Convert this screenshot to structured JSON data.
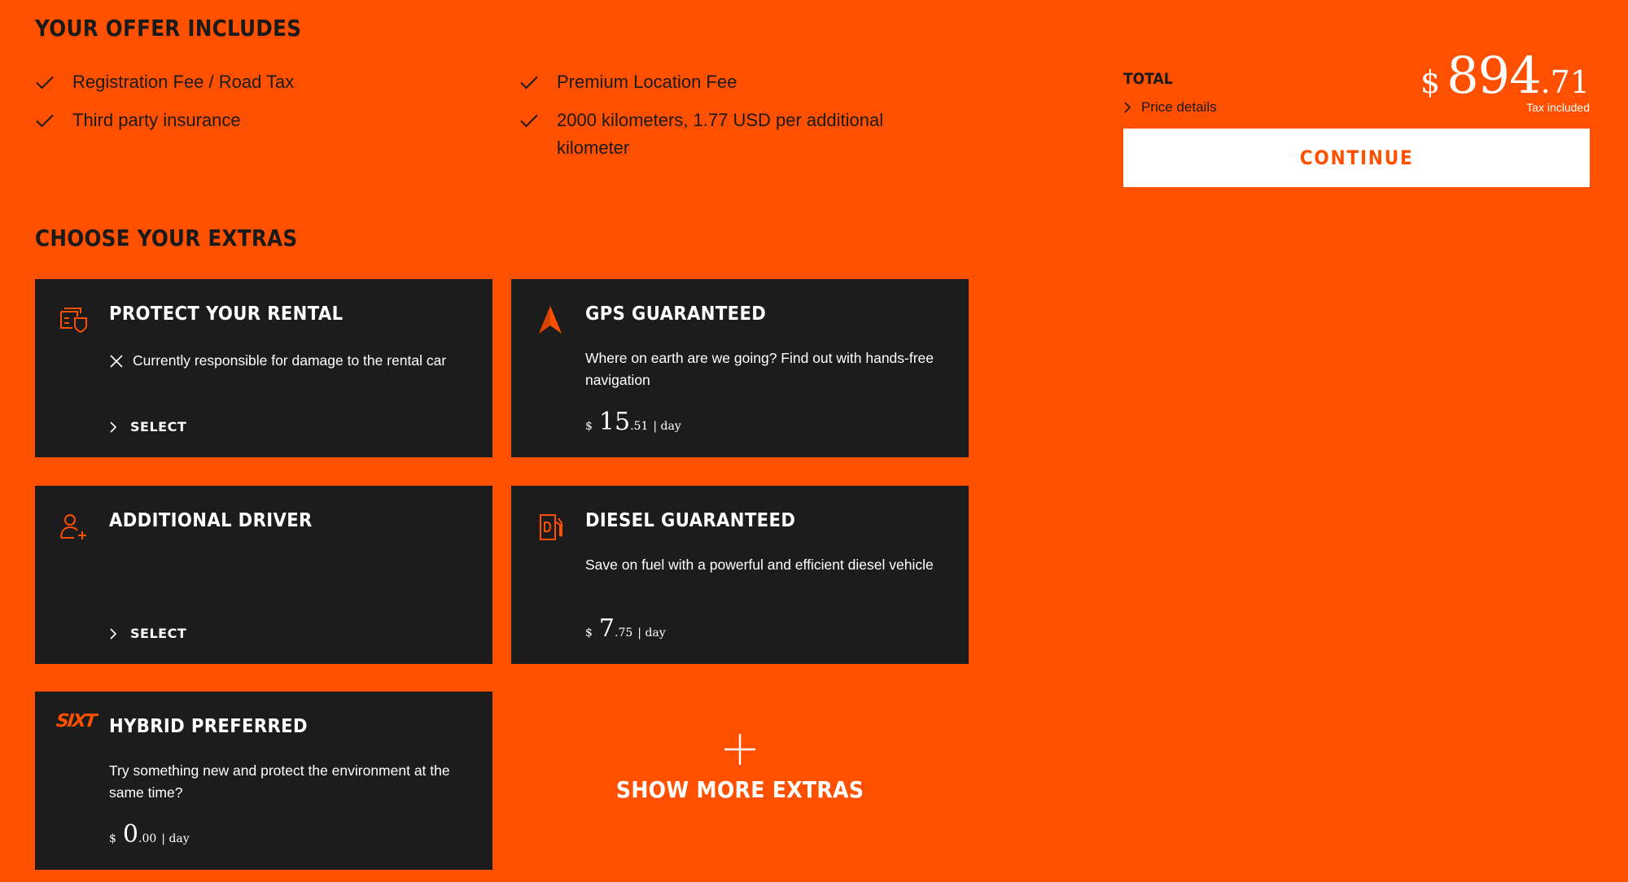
{
  "offer": {
    "title": "YOUR OFFER INCLUDES",
    "column_1": [
      "Registration Fee / Road Tax",
      "Third party insurance"
    ],
    "column_2": [
      "Premium Location Fee",
      "2000 kilometers, 1.77 USD per additional kilometer"
    ]
  },
  "total": {
    "label": "TOTAL",
    "price_details": "Price details",
    "currency": "$",
    "price_int": "894",
    "price_dec": ".71",
    "tax_note": "Tax included",
    "continue_label": "CONTINUE"
  },
  "extras": {
    "title": "CHOOSE YOUR EXTRAS",
    "cards": [
      {
        "title": "PROTECT YOUR RENTAL",
        "warning": "Currently responsible for damage to the rental car",
        "action": "SELECT",
        "icon": "protection-shield-icon"
      },
      {
        "title": "GPS GUARANTEED",
        "description": "Where on earth are we going? Find out with hands-free navigation",
        "currency": "$",
        "price_int": "15",
        "price_dec": ".51",
        "per": "| day",
        "icon": "navigation-arrow-icon"
      },
      {
        "title": "ADDITIONAL DRIVER",
        "action": "SELECT",
        "icon": "add-person-icon"
      },
      {
        "title": "DIESEL GUARANTEED",
        "description": "Save on fuel with a powerful and efficient diesel vehicle",
        "currency": "$",
        "price_int": "7",
        "price_dec": ".75",
        "per": "| day",
        "icon": "diesel-pump-icon"
      },
      {
        "title": "HYBRID PREFERRED",
        "description": "Try something new and protect the environment at the same time?",
        "currency": "$",
        "price_int": "0",
        "price_dec": ".00",
        "per": "| day",
        "logo": "SIXT"
      }
    ],
    "show_more": "SHOW MORE EXTRAS"
  },
  "colors": {
    "background": "#ff5000",
    "card": "#1c1c1c",
    "accent": "#ff5000",
    "text_dark": "#1a1a1a",
    "text_light": "#ffffff"
  }
}
